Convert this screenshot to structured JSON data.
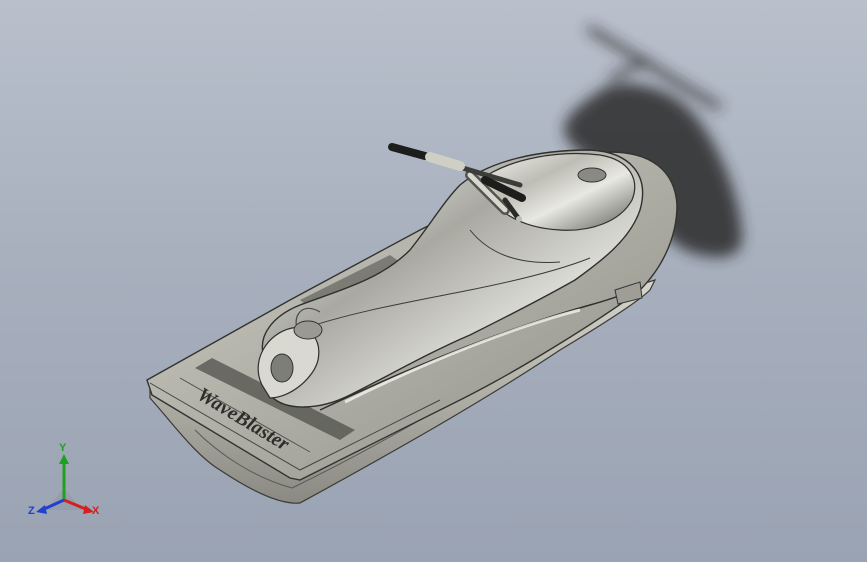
{
  "model": {
    "deck_lettering": "WaveBlaster"
  },
  "triad": {
    "x_label": "X",
    "y_label": "Y",
    "z_label": "Z",
    "x_color": "#d42020",
    "y_color": "#20a020",
    "z_color": "#2040d0"
  },
  "colors": {
    "background_top": "#b9c0cc",
    "background_bottom": "#9aa3b3",
    "hull_metal": "#cfcfc8",
    "shadow": "#2a2a2a"
  }
}
